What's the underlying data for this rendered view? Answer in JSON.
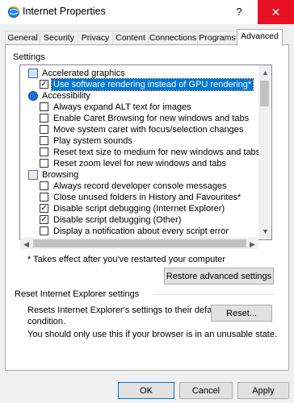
{
  "window": {
    "title": "Internet Properties",
    "help": "?",
    "close": "✕",
    "icon": "globe-icon"
  },
  "tabs": [
    "General",
    "Security",
    "Privacy",
    "Content",
    "Connections",
    "Programs",
    "Advanced"
  ],
  "active_tab": "Advanced",
  "settings": {
    "label": "Settings",
    "items": [
      {
        "type": "group",
        "label": "Accelerated graphics",
        "icon": "monitor-icon"
      },
      {
        "type": "check",
        "label": "Use software rendering instead of GPU rendering*",
        "checked": true,
        "selected": true
      },
      {
        "type": "group",
        "label": "Accessibility",
        "icon": "accessibility-icon"
      },
      {
        "type": "check",
        "label": "Always expand ALT text for images",
        "checked": false
      },
      {
        "type": "check",
        "label": "Enable Caret Browsing for new windows and tabs",
        "checked": false
      },
      {
        "type": "check",
        "label": "Move system caret with focus/selection changes",
        "checked": false
      },
      {
        "type": "check",
        "label": "Play system sounds",
        "checked": false
      },
      {
        "type": "check",
        "label": "Reset text size to medium for new windows and tabs",
        "checked": false
      },
      {
        "type": "check",
        "label": "Reset zoom level for new windows and tabs",
        "checked": false
      },
      {
        "type": "group",
        "label": "Browsing",
        "icon": "browsing-icon"
      },
      {
        "type": "check",
        "label": "Always record developer console messages",
        "checked": false
      },
      {
        "type": "check",
        "label": "Close unused folders in History and Favourites*",
        "checked": false
      },
      {
        "type": "check",
        "label": "Disable script debugging (Internet Explorer)",
        "checked": true
      },
      {
        "type": "check",
        "label": "Disable script debugging (Other)",
        "checked": true
      },
      {
        "type": "check",
        "label": "Display a notification about every script error",
        "checked": false
      }
    ]
  },
  "footnote": "* Takes effect after you've restarted your computer",
  "restore_button": "Restore advanced settings",
  "reset": {
    "heading": "Reset Internet Explorer settings",
    "desc_line1": "Resets Internet Explorer's settings to their default",
    "desc_line2": "condition.",
    "button": "Reset...",
    "warning": "You should only use this if your browser is in an unusable state."
  },
  "footer": {
    "ok": "OK",
    "cancel": "Cancel",
    "apply": "Apply"
  }
}
